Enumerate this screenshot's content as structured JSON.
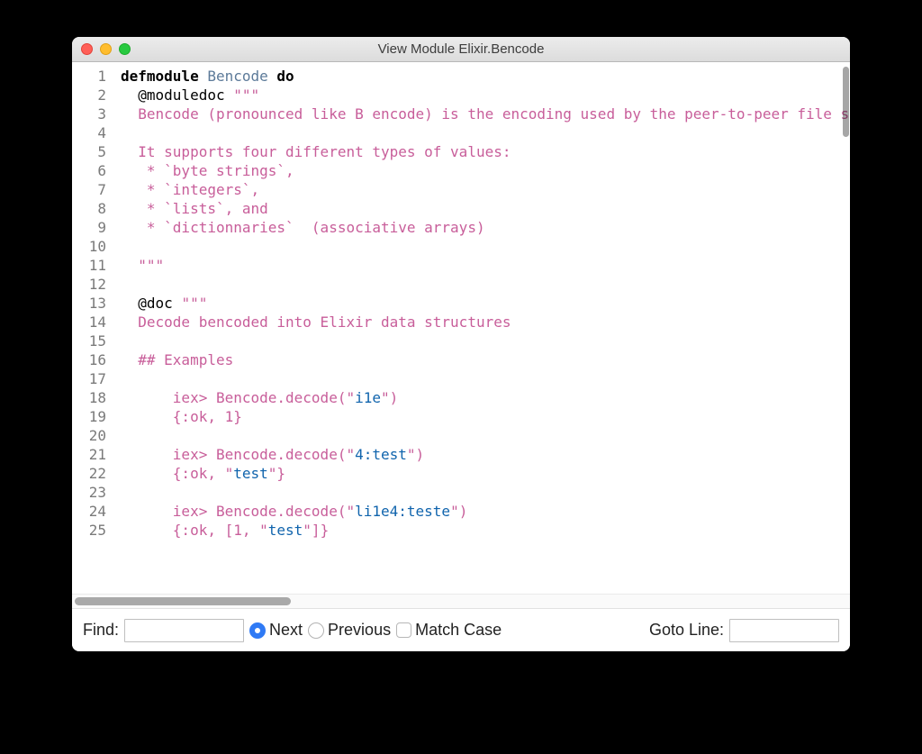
{
  "window": {
    "title": "View Module Elixir.Bencode"
  },
  "code": {
    "lines_count": 25,
    "lines": [
      {
        "tokens": [
          {
            "c": "kw",
            "t": "defmodule"
          },
          {
            "c": "",
            "t": " "
          },
          {
            "c": "mod",
            "t": "Bencode"
          },
          {
            "c": "",
            "t": " "
          },
          {
            "c": "kw",
            "t": "do"
          }
        ]
      },
      {
        "tokens": [
          {
            "c": "",
            "t": "  @moduledoc "
          },
          {
            "c": "doc",
            "t": "\"\"\""
          }
        ]
      },
      {
        "tokens": [
          {
            "c": "doc",
            "t": "  Bencode (pronounced like B encode) is the encoding used by the peer-to-peer file sharing"
          }
        ]
      },
      {
        "tokens": []
      },
      {
        "tokens": [
          {
            "c": "doc",
            "t": "  It supports four different types of values:"
          }
        ]
      },
      {
        "tokens": [
          {
            "c": "doc",
            "t": "   * `byte strings`,"
          }
        ]
      },
      {
        "tokens": [
          {
            "c": "doc",
            "t": "   * `integers`,"
          }
        ]
      },
      {
        "tokens": [
          {
            "c": "doc",
            "t": "   * `lists`, and"
          }
        ]
      },
      {
        "tokens": [
          {
            "c": "doc",
            "t": "   * `dictionnaries`  (associative arrays)"
          }
        ]
      },
      {
        "tokens": []
      },
      {
        "tokens": [
          {
            "c": "doc",
            "t": "  \"\"\""
          }
        ]
      },
      {
        "tokens": []
      },
      {
        "tokens": [
          {
            "c": "",
            "t": "  @doc "
          },
          {
            "c": "doc",
            "t": "\"\"\""
          }
        ]
      },
      {
        "tokens": [
          {
            "c": "doc",
            "t": "  Decode bencoded into Elixir data structures"
          }
        ]
      },
      {
        "tokens": []
      },
      {
        "tokens": [
          {
            "c": "doc",
            "t": "  ## Examples"
          }
        ]
      },
      {
        "tokens": []
      },
      {
        "tokens": [
          {
            "c": "doc",
            "t": "      iex> Bencode.decode(\""
          },
          {
            "c": "str-inner",
            "t": "i1e"
          },
          {
            "c": "doc",
            "t": "\")"
          }
        ]
      },
      {
        "tokens": [
          {
            "c": "doc",
            "t": "      {:ok, 1}"
          }
        ]
      },
      {
        "tokens": []
      },
      {
        "tokens": [
          {
            "c": "doc",
            "t": "      iex> Bencode.decode(\""
          },
          {
            "c": "str-inner",
            "t": "4:test"
          },
          {
            "c": "doc",
            "t": "\")"
          }
        ]
      },
      {
        "tokens": [
          {
            "c": "doc",
            "t": "      {:ok, \""
          },
          {
            "c": "str-inner",
            "t": "test"
          },
          {
            "c": "doc",
            "t": "\"}"
          }
        ]
      },
      {
        "tokens": []
      },
      {
        "tokens": [
          {
            "c": "doc",
            "t": "      iex> Bencode.decode(\""
          },
          {
            "c": "str-inner",
            "t": "li1e4:teste"
          },
          {
            "c": "doc",
            "t": "\")"
          }
        ]
      },
      {
        "tokens": [
          {
            "c": "doc",
            "t": "      {:ok, [1, \""
          },
          {
            "c": "str-inner",
            "t": "test"
          },
          {
            "c": "doc",
            "t": "\"]}"
          }
        ]
      }
    ]
  },
  "findbar": {
    "find_label": "Find:",
    "next_label": "Next",
    "previous_label": "Previous",
    "match_case_label": "Match Case",
    "goto_label": "Goto Line:",
    "find_value": "",
    "goto_value": "",
    "selected_direction": "next",
    "match_case_checked": false
  }
}
